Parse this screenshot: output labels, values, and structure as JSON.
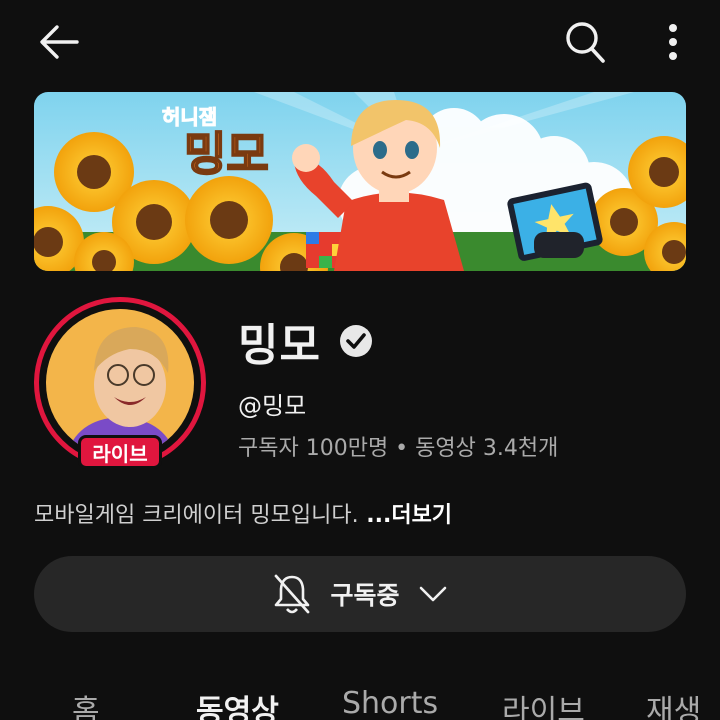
{
  "header": {
    "back_icon": "arrow-left-icon",
    "search_icon": "search-icon",
    "more_icon": "more-vertical-icon"
  },
  "banner": {
    "logo_small": "허니잼",
    "logo_large": "밍모"
  },
  "channel": {
    "name": "밍모",
    "handle": "@밍모",
    "stats": "구독자 100만명 • 동영상 3.4천개",
    "description": "모바일게임 크리에이터 밍모입니다.",
    "more_link": " ...더보기",
    "live_badge": "라이브",
    "verified_icon": "verified-check-icon"
  },
  "subscribe": {
    "label": "구독중",
    "bell_icon": "bell-off-icon",
    "chevron_icon": "chevron-down-icon"
  },
  "tabs": [
    {
      "label": "홈",
      "active": false
    },
    {
      "label": "동영상",
      "active": true
    },
    {
      "label": "Shorts",
      "active": false
    },
    {
      "label": "라이브",
      "active": false
    },
    {
      "label": "재생",
      "active": false
    }
  ],
  "colors": {
    "background": "#0f0f0f",
    "live_red": "#e0163e",
    "button_bg": "#272727",
    "muted_text": "#aaaaaa"
  }
}
